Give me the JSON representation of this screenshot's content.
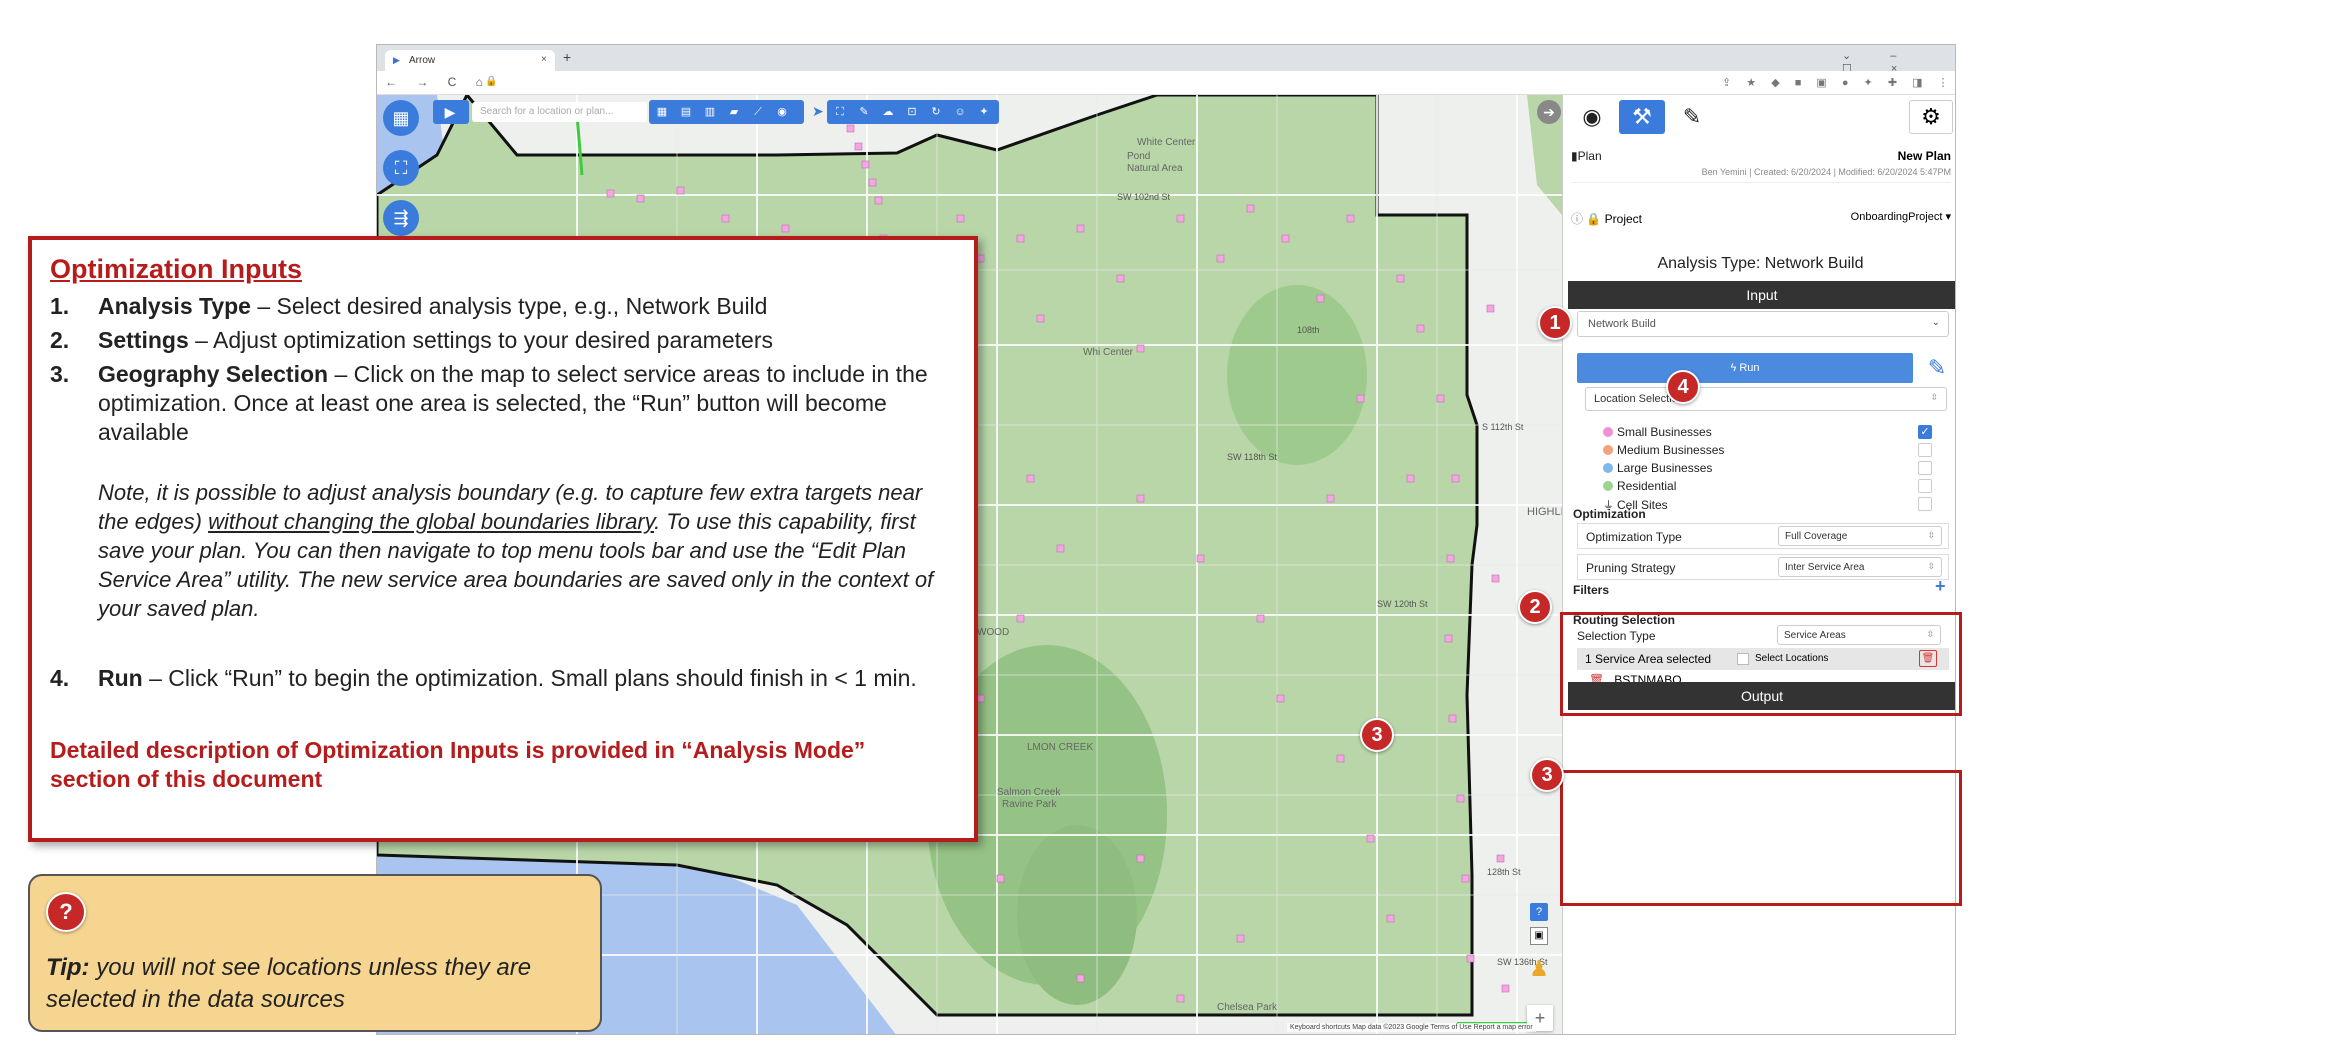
{
  "browser": {
    "tab_title": "Arrow",
    "tab_close": "×",
    "new_tab": "+",
    "window_controls": "⌄ – ☐ ×",
    "nav_buttons": "← → C ⌂",
    "lock": "🔒",
    "extensions": "⇪ ★ ◆ ■ ▣ ● ✦ ✚ ◨ ⋮"
  },
  "map": {
    "search_placeholder": "Search for a location or plan...",
    "zoom_in": "+",
    "zoom_out": "−",
    "help": "?",
    "footer": "Keyboard shortcuts   Map data ©2023 Google   Terms of Use   Report a map error",
    "labels": {
      "white_center": "White Center",
      "white_center_pond": "White Center Pond Natural Area",
      "whi_center": "Whi Center",
      "highline": "HIGHLIN",
      "wood": "WOOD",
      "almon_creek": "LMON CREEK",
      "salmon_creek": "Salmon Creek Ravine Park",
      "chelsea_park": "Chelsea Park",
      "sw_102nd": "SW 102nd St",
      "sw_108th": "108th",
      "sw_116th": "SW 116th St",
      "sw_118th": "SW 118th St",
      "sw_120th": "SW 120th St",
      "sw_128th": "128th St",
      "sw_136th": "SW 136th St",
      "s_112th": "S 112th St",
      "s_128th": "S 128th St"
    }
  },
  "panel": {
    "plan_label": "Plan",
    "plan_name": "New Plan",
    "plan_meta": "Ben Yemini | Created: 6/20/2024 | Modified: 6/20/2024 5:47PM",
    "project_label": "Project",
    "project_value": "OnboardingProject",
    "analysis_title": "Analysis Type: Network Build",
    "input_bar": "Input",
    "analysis_select": "Network Build",
    "run_label": "Run",
    "location_selection": "Location Selection",
    "locations": [
      {
        "label": "Small Businesses",
        "color": "#f08fd4",
        "checked": true
      },
      {
        "label": "Medium Businesses",
        "color": "#f4a27a",
        "checked": false
      },
      {
        "label": "Large Businesses",
        "color": "#7fb6ee",
        "checked": false
      },
      {
        "label": "Residential",
        "color": "#9bd38f",
        "checked": false
      },
      {
        "label": "Cell Sites",
        "color": "#555555",
        "checked": false
      }
    ],
    "optimization_head": "Optimization",
    "optimization_type_label": "Optimization Type",
    "optimization_type_value": "Full Coverage",
    "pruning_label": "Pruning Strategy",
    "pruning_value": "Inter Service Area",
    "filters_head": "Filters",
    "filters_add": "+",
    "routing_head": "Routing Selection",
    "selection_type_label": "Selection Type",
    "selection_type_value": "Service Areas",
    "service_area_count": "1 Service Area selected",
    "select_locations": "Select Locations",
    "service_area_item": "BSTNMABO",
    "output_bar": "Output"
  },
  "badges": {
    "one": "1",
    "two": "2",
    "three": "3",
    "four": "4"
  },
  "callout": {
    "title": "Optimization Inputs",
    "steps": [
      {
        "num": "1.",
        "head": "Analysis Type",
        "text": " – Select desired analysis type, e.g., Network Build"
      },
      {
        "num": "2.",
        "head": "Settings",
        "text": " – Adjust optimization settings to your desired parameters"
      },
      {
        "num": "3.",
        "head": "Geography Selection",
        "text": " – Click on the map to select service areas to include in the optimization. Once at least one area is selected, the “Run” button will become available"
      },
      {
        "num": "4.",
        "head": "Run",
        "text": " – Click “Run” to begin the optimization. Small plans should finish in < 1 min."
      }
    ],
    "note_a": "Note, it is possible to adjust analysis boundary (e.g. to capture few extra targets near the edges) ",
    "note_underline": "without changing the global boundaries library",
    "note_b": ". To use this capability, first save your plan. You can then navigate to top menu tools bar and use the “Edit Plan Service Area” utility. The new service area boundaries are saved only in the context of your saved plan.",
    "footer": "Detailed description of Optimization Inputs is provided in “Analysis Mode” section of this document"
  },
  "tip": {
    "badge": "?",
    "label": "Tip:",
    "text": " you will not see locations unless they are selected in the data sources"
  },
  "colors": {
    "accent_red": "#b71c1c",
    "brand_blue": "#3b7bdc",
    "map_green": "#b8d6a8",
    "tip_yellow": "#f6d590"
  }
}
